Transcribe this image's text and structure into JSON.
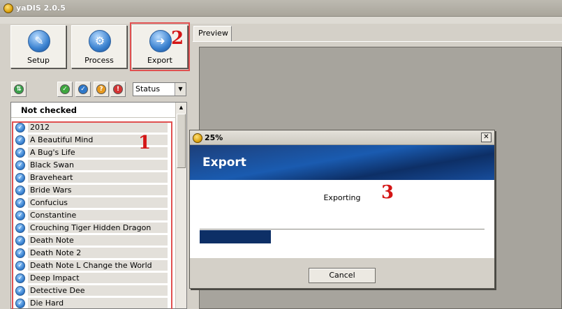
{
  "window": {
    "title": "yaDIS 2.0.5"
  },
  "toolbar": {
    "setup_label": "Setup",
    "process_label": "Process",
    "export_label": "Export"
  },
  "markers": {
    "one": "1",
    "two": "2",
    "three": "3"
  },
  "filters": {
    "status_value": "Status"
  },
  "list": {
    "header": "Not checked",
    "items": [
      "2012",
      "A Beautiful Mind",
      "A Bug's Life",
      "Black Swan",
      "Braveheart",
      "Bride Wars",
      "Confucius",
      "Constantine",
      "Crouching Tiger Hidden Dragon",
      "Death Note",
      "Death Note 2",
      "Death Note L Change the World",
      "Deep Impact",
      "Detective Dee",
      "Die Hard"
    ]
  },
  "preview": {
    "tab_label": "Preview"
  },
  "dialog": {
    "title": "25%",
    "heading": "Export",
    "message": "Exporting",
    "progress_percent": 25,
    "cancel_label": "Cancel"
  },
  "colors": {
    "highlight": "#e05050",
    "marker": "#d41515",
    "banner": "#1a5bb0",
    "progress": "#0d2f66"
  }
}
